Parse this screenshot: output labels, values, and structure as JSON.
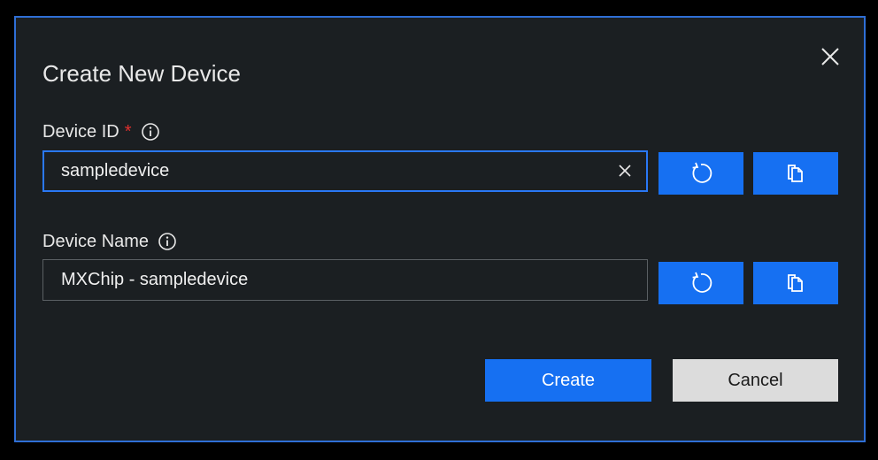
{
  "dialog": {
    "title": "Create New Device",
    "close_icon": "close-icon"
  },
  "device_id": {
    "label": "Device ID",
    "required_mark": "*",
    "info_icon": "info-icon",
    "value": "sampledevice",
    "clear_icon": "clear-icon",
    "regenerate_icon": "refresh-icon",
    "copy_icon": "copy-icon"
  },
  "device_name": {
    "label": "Device Name",
    "info_icon": "info-icon",
    "value": "MXChip - sampledevice",
    "regenerate_icon": "refresh-icon",
    "copy_icon": "copy-icon"
  },
  "buttons": {
    "create_label": "Create",
    "cancel_label": "Cancel"
  },
  "colors": {
    "accent": "#1670f2",
    "dialog_background": "#1b1f22",
    "dialog_border": "#2f6fd6",
    "required": "#e0302e",
    "cancel_background": "#dcdcdc"
  }
}
